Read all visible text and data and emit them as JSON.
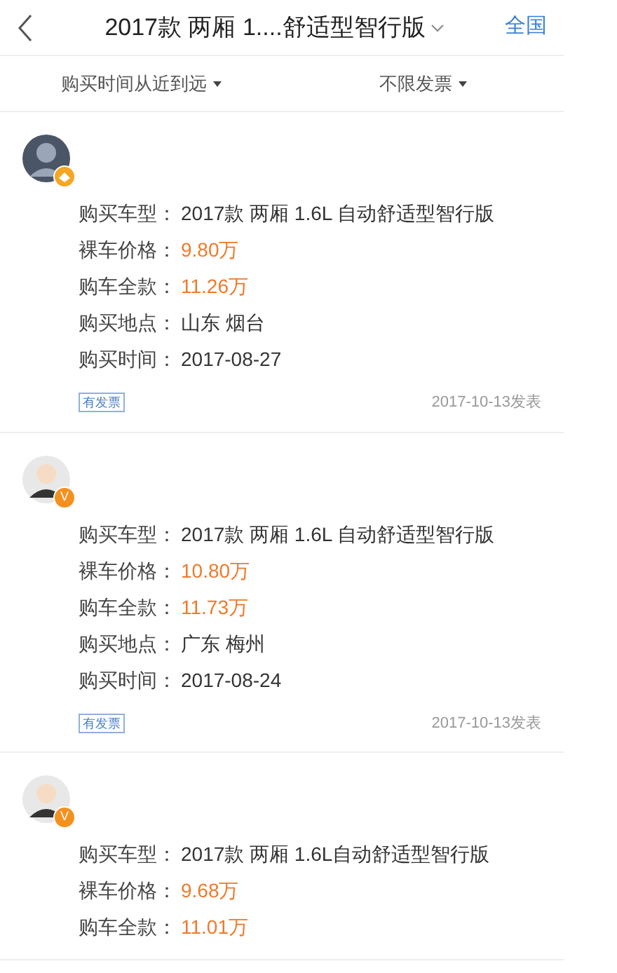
{
  "header": {
    "title": "2017款 两厢 1....舒适型智行版",
    "region": "全国"
  },
  "filters": [
    {
      "label": "购买时间从近到远"
    },
    {
      "label": "不限发票"
    }
  ],
  "posts": [
    {
      "badge": {
        "kind": "icon"
      },
      "fields": [
        {
          "label": "购买车型：",
          "value": "2017款 两厢 1.6L 自动舒适型智行版",
          "highlight": false
        },
        {
          "label": "裸车价格：",
          "value": "9.80万",
          "highlight": true
        },
        {
          "label": "购车全款：",
          "value": "11.26万",
          "highlight": true
        },
        {
          "label": "购买地点：",
          "value": "山东 烟台",
          "highlight": false
        },
        {
          "label": "购买时间：",
          "value": "2017-08-27",
          "highlight": false
        }
      ],
      "tag": "有发票",
      "date": "2017-10-13发表"
    },
    {
      "badge": {
        "kind": "letter",
        "text": "V"
      },
      "fields": [
        {
          "label": "购买车型：",
          "value": "2017款 两厢 1.6L 自动舒适型智行版",
          "highlight": false
        },
        {
          "label": "裸车价格：",
          "value": "10.80万",
          "highlight": true
        },
        {
          "label": "购车全款：",
          "value": "11.73万",
          "highlight": true
        },
        {
          "label": "购买地点：",
          "value": "广东 梅州",
          "highlight": false
        },
        {
          "label": "购买时间：",
          "value": "2017-08-24",
          "highlight": false
        }
      ],
      "tag": "有发票",
      "date": "2017-10-13发表"
    },
    {
      "badge": {
        "kind": "letter",
        "text": "V"
      },
      "fields": [
        {
          "label": "购买车型：",
          "value": "2017款 两厢 1.6L自动舒适型智行版",
          "highlight": false
        },
        {
          "label": "裸车价格：",
          "value": "9.68万",
          "highlight": true
        },
        {
          "label": "购车全款：",
          "value": "11.01万",
          "highlight": true
        }
      ]
    }
  ]
}
